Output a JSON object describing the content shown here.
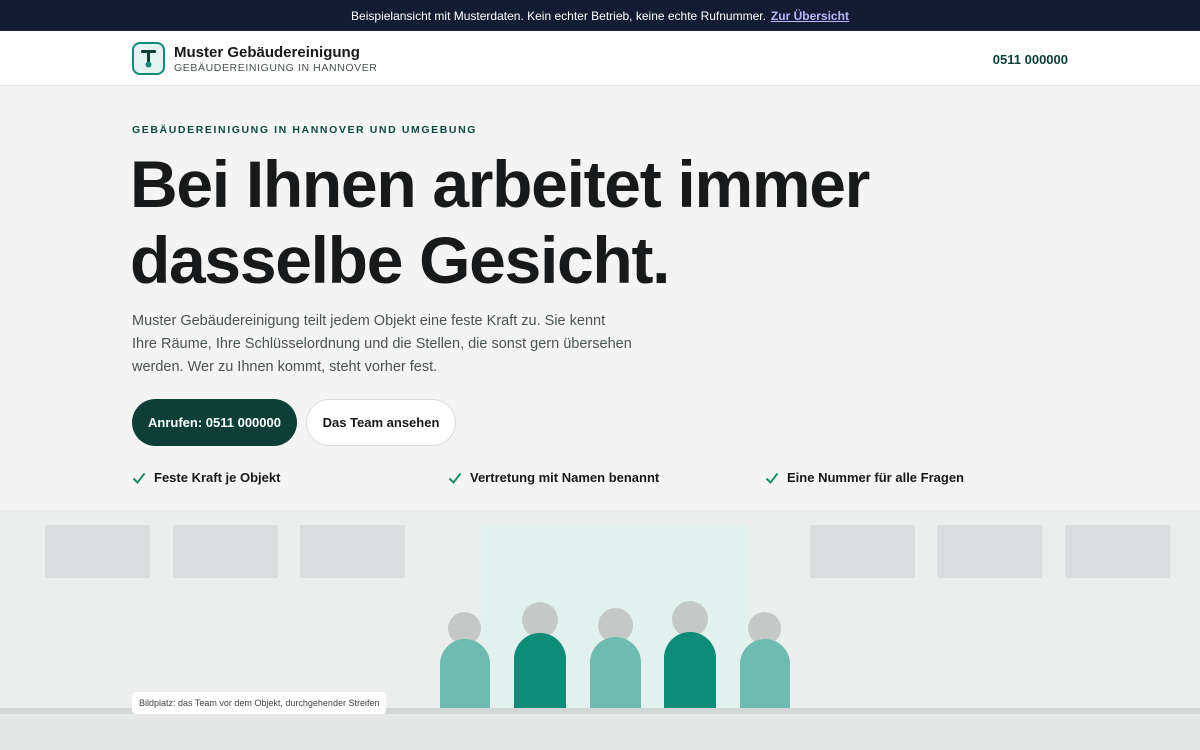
{
  "banner": {
    "text": "Beispielansicht mit Musterdaten. Kein echter Betrieb, keine echte Rufnummer.",
    "link": "Zur Übersicht"
  },
  "header": {
    "brand_name": "Muster Gebäudereinigung",
    "brand_sub": "GEBÄUDEREINIGUNG IN HANNOVER",
    "phone": "0511 000000"
  },
  "hero": {
    "eyebrow": "GEBÄUDEREINIGUNG IN HANNOVER UND UMGEBUNG",
    "headline_line1": "Bei Ihnen arbeitet immer",
    "headline_line2": "dasselbe Gesicht.",
    "lead": "Muster Gebäudereinigung teilt jedem Objekt eine feste Kraft zu. Sie kennt Ihre Räume, Ihre Schlüsselordnung und die Stellen, die sonst gern übersehen werden. Wer zu Ihnen kommt, steht vorher fest.",
    "cta_primary": "Anrufen: 0511 000000",
    "cta_secondary": "Das Team ansehen"
  },
  "features": [
    {
      "label": "Feste Kraft je Objekt",
      "icon": "check-icon"
    },
    {
      "label": "Vertretung mit Namen benannt",
      "icon": "check-icon"
    },
    {
      "label": "Eine Nummer für alle Fragen",
      "icon": "check-icon"
    }
  ],
  "illustration": {
    "caption": "Bildplatz: das Team vor dem Objekt, durchgehender Streifen"
  },
  "colors": {
    "banner_bg": "#141c33",
    "brand_dark_green": "#0d3f36",
    "accent_green": "#0f8c78",
    "light_green": "#6dbcaf",
    "check_green": "#1e8c6e"
  }
}
